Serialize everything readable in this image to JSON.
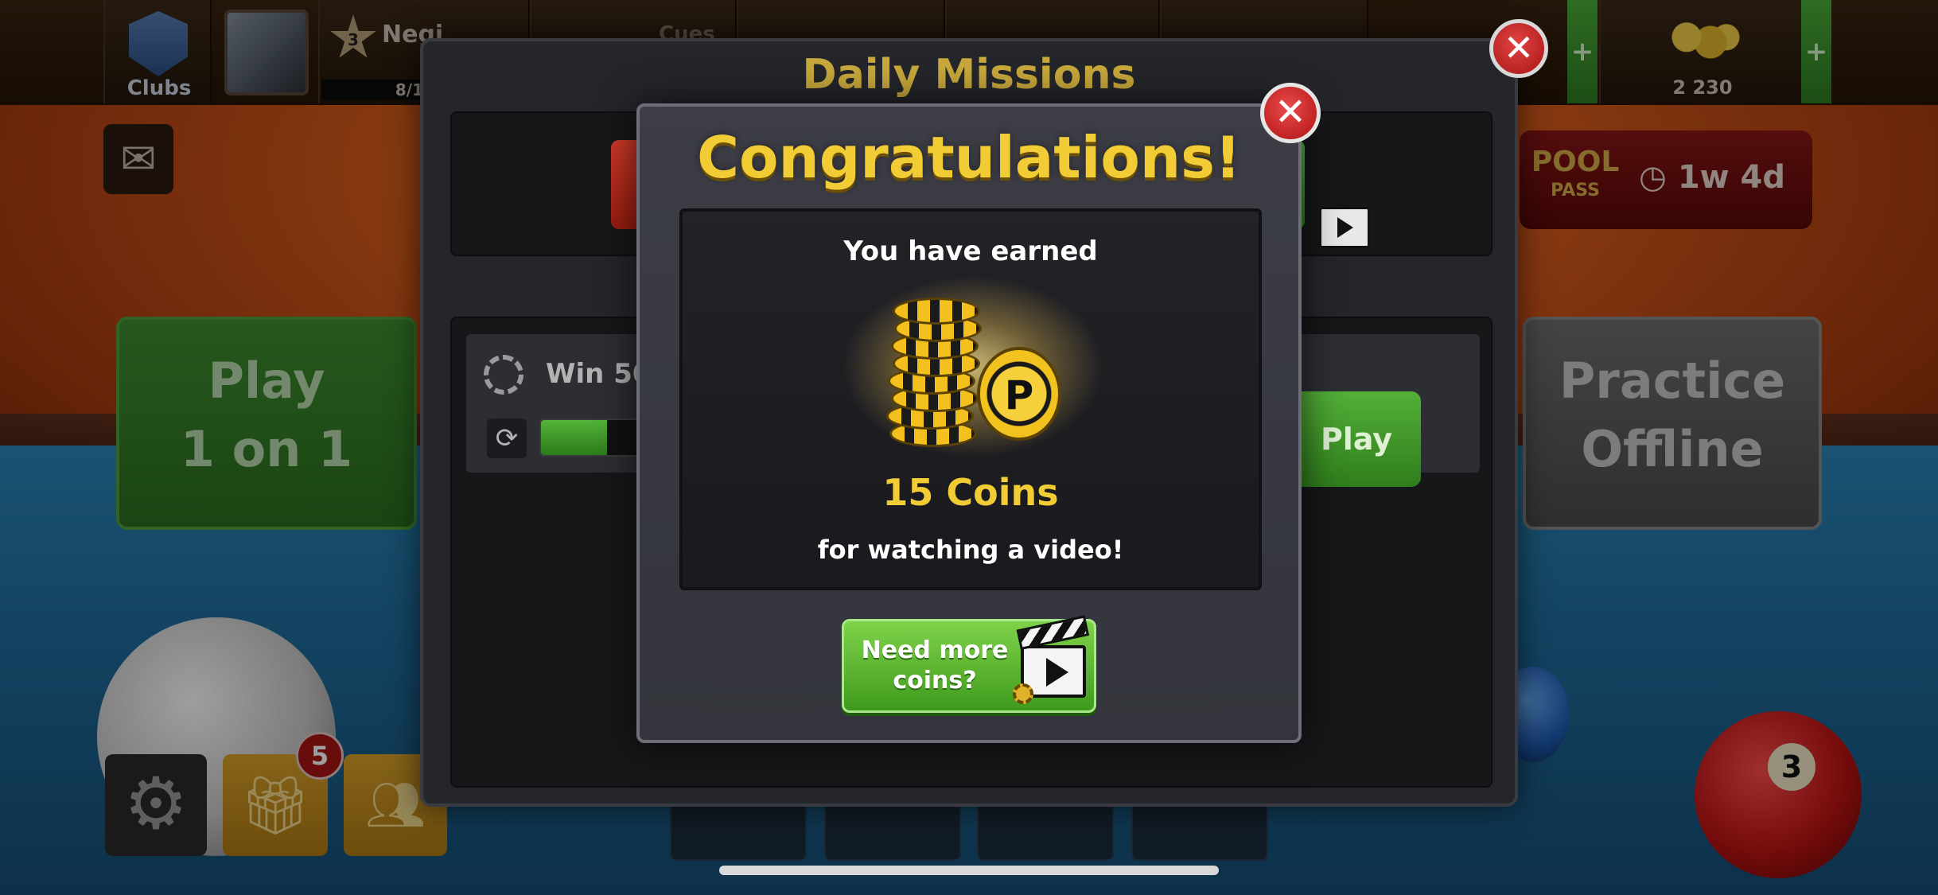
{
  "top_bar": {
    "clubs_label": "Clubs",
    "level": "3",
    "player_name": "Negi",
    "xp_progress": "8/1",
    "cues_label": "Cues",
    "coins": "2 230",
    "plus": "+"
  },
  "side": {
    "mail_icon": "envelope-icon",
    "play_line1": "Play",
    "play_line2": "1 on 1",
    "practice_line1": "Practice",
    "practice_line2": "Offline",
    "pool_pass_logo_line1": "POOL",
    "pool_pass_logo_line2": "PASS",
    "pool_pass_timer": "1w 4d",
    "gift_badge": "5",
    "ball_number": "3"
  },
  "missions": {
    "title": "Daily Missions",
    "close_glyph": "✕",
    "mission_text": "Win 50",
    "play_label": "Play",
    "refresh_glyph": "⟳",
    "progress": 0.14
  },
  "congrats": {
    "title": "Congratulations!",
    "close_glyph": "✕",
    "earned_label": "You have earned",
    "amount": "15 Coins",
    "reason": "for watching a video!",
    "more_coins_line1": "Need more",
    "more_coins_line2": "coins?",
    "coin_letter": "P"
  },
  "colors": {
    "accent_gold": "#f2cc34",
    "close_red": "#b01414",
    "button_green": "#3f9a1c"
  }
}
